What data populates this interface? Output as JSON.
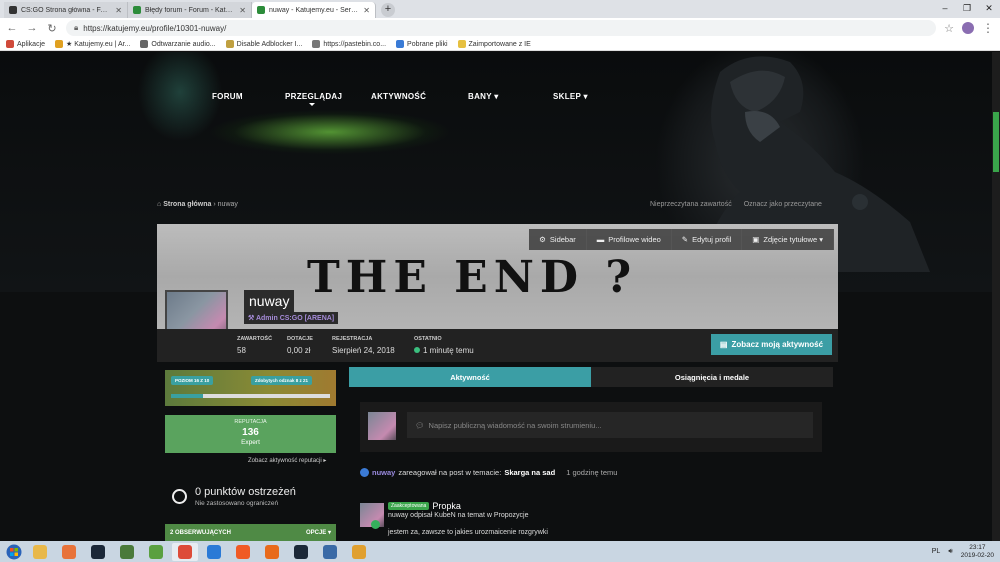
{
  "browser": {
    "tabs": [
      {
        "title": "CS:GO Strona główna - FACEIT.c",
        "color": "#333333",
        "active": false
      },
      {
        "title": "Błędy forum - Forum - Katujemy",
        "color": "#2c8c3a",
        "active": false
      },
      {
        "title": "nuway - Katujemy.eu - Serwery C",
        "color": "#2c8c3a",
        "active": true
      }
    ],
    "new_tab": "+",
    "window_controls": [
      "–",
      "❐",
      "✕"
    ],
    "url": "https://katujemy.eu/profile/10301-nuway/",
    "bookmarks": [
      {
        "label": "Aplikacje",
        "color": "#d04a3a"
      },
      {
        "label": "★ Katujemy.eu | Ar...",
        "color": "#e0a020"
      },
      {
        "label": "Odtwarzanie audio...",
        "color": "#666666"
      },
      {
        "label": "Disable Adblocker I...",
        "color": "#c0a040"
      },
      {
        "label": "https://pastebin.co...",
        "color": "#777777"
      },
      {
        "label": "Pobrane pliki",
        "color": "#3a7bd6"
      },
      {
        "label": "Zaimportowane z IE",
        "color": "#e6c040"
      }
    ]
  },
  "site": {
    "nav": [
      "FORUM",
      "PRZEGLĄDAJ",
      "AKTYWNOŚĆ",
      "BANY ▾",
      "SKLEP ▾"
    ],
    "breadcrumb": {
      "home": "Strona główna",
      "current": "nuway"
    },
    "breadcrumb_right": [
      "Nieprzeczytana zawartość",
      "Oznacz jako przeczytane"
    ]
  },
  "profile": {
    "cover_text": "THE END ?",
    "cover_buttons": [
      "Sidebar",
      "Profilowe wideo",
      "Edytuj profil",
      "Zdjęcie tytułowe ▾"
    ],
    "username": "nuway",
    "group": "Admin CS:GO [ARENA]",
    "stats": [
      {
        "label": "ZAWARTOŚĆ",
        "value": "58"
      },
      {
        "label": "DOTACJE",
        "value": "0,00 zł"
      },
      {
        "label": "REJESTRACJA",
        "value": "Sierpień 24, 2018"
      },
      {
        "label": "OSTATNIO",
        "value": "1 minutę temu"
      }
    ],
    "activity_button": "Zobacz moją aktywność"
  },
  "sidebar": {
    "level_pill": "POZIOM 16 Z 10",
    "badges_pill": "Zdobytych odznak 8 z 21",
    "level_progress": 0.2,
    "reputation_title": "REPUTACJA",
    "reputation_value": "136",
    "reputation_rank": "Expert",
    "reputation_link": "Zobacz aktywność reputacji ▸",
    "warnings_title": "0 punktów ostrzeżeń",
    "warnings_sub": "Nie zastosowano ograniczeń",
    "followers": "2 OBSERWUJĄCYCH",
    "followers_options": "OPCJE ▾"
  },
  "feed": {
    "tabs": [
      "Aktywność",
      "Osiągnięcia i medale"
    ],
    "composer_placeholder": "Napisz publiczną wiadomość na swoim strumieniu...",
    "activity": {
      "user": "nuway",
      "text": "zareagował na post w temacie:",
      "topic": "Skarga na sad",
      "time": "1 godzinę temu"
    },
    "post": {
      "tag": "Zaakceptowana",
      "title": "Propka",
      "meta": "nuway odpisał KubeN na temat w Propozycje",
      "body": "jestem za, zawsze to jakies urozmaicenie rozgrywki"
    }
  },
  "taskbar": {
    "icons": [
      {
        "name": "explorer-icon",
        "color": "#e8b84a"
      },
      {
        "name": "media-player-icon",
        "color": "#e8733a"
      },
      {
        "name": "steam-icon",
        "color": "#1b2838"
      },
      {
        "name": "app-icon",
        "color": "#4a7a3a"
      },
      {
        "name": "vectr-icon",
        "color": "#5aa040"
      },
      {
        "name": "chrome-icon",
        "color": "#dd4b39"
      },
      {
        "name": "calendar-icon",
        "color": "#2a7ad6"
      },
      {
        "name": "brave-icon",
        "color": "#f05a24"
      },
      {
        "name": "firefox-icon",
        "color": "#e86a1a"
      },
      {
        "name": "steam2-icon",
        "color": "#1b2838"
      },
      {
        "name": "teamspeak-icon",
        "color": "#3a6aa6"
      },
      {
        "name": "csgo-icon",
        "color": "#e0a030"
      }
    ],
    "lang": "PL",
    "time": "23:17",
    "date": "2019-02-20"
  }
}
